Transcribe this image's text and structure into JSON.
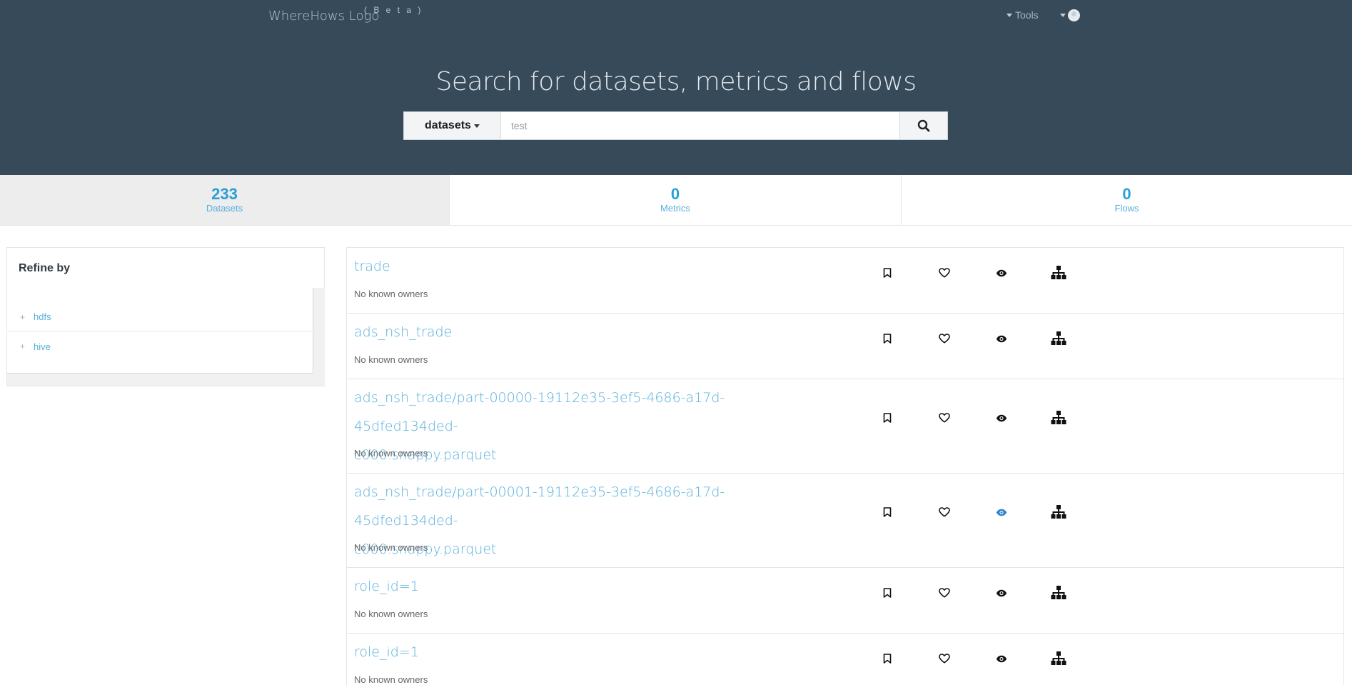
{
  "header": {
    "logo": "WhereHows Logo",
    "beta": "( B e t a )",
    "tools_label": "Tools",
    "hero_title": "Search for datasets, metrics and flows"
  },
  "search": {
    "type_label": "datasets",
    "value": "",
    "placeholder": "test"
  },
  "counts": [
    {
      "num": "233",
      "label": "Datasets",
      "active": true
    },
    {
      "num": "0",
      "label": "Metrics",
      "active": false
    },
    {
      "num": "0",
      "label": "Flows",
      "active": false
    }
  ],
  "refine": {
    "title": "Refine by",
    "items": [
      {
        "label": "hdfs"
      },
      {
        "label": "hive"
      }
    ]
  },
  "results": [
    {
      "title_line1": "trade",
      "title_line2": "",
      "owner": "No known owners",
      "watched": false
    },
    {
      "title_line1": "ads_nsh_trade",
      "title_line2": "",
      "owner": "No known owners",
      "watched": false
    },
    {
      "title_line1": "ads_nsh_trade/part-00000-19112e35-3ef5-4686-a17d-45dfed134ded-",
      "title_line2": "c000.snappy.parquet",
      "owner": "No known owners",
      "watched": false
    },
    {
      "title_line1": "ads_nsh_trade/part-00001-19112e35-3ef5-4686-a17d-45dfed134ded-",
      "title_line2": "c000.snappy.parquet",
      "owner": "No known owners",
      "watched": true
    },
    {
      "title_line1": "role_id=1",
      "title_line2": "",
      "owner": "No known owners",
      "watched": false
    },
    {
      "title_line1": "role_id=1",
      "title_line2": "",
      "owner": "No known owners",
      "watched": false
    }
  ],
  "colors": {
    "header_bg": "#364a5a",
    "link": "#57b0db",
    "count": "#2a9fd6",
    "watched_icon": "#2a7fd0",
    "icon": "#111111"
  },
  "icons": [
    "bookmark-icon",
    "heart-icon",
    "eye-icon",
    "sitemap-icon"
  ]
}
